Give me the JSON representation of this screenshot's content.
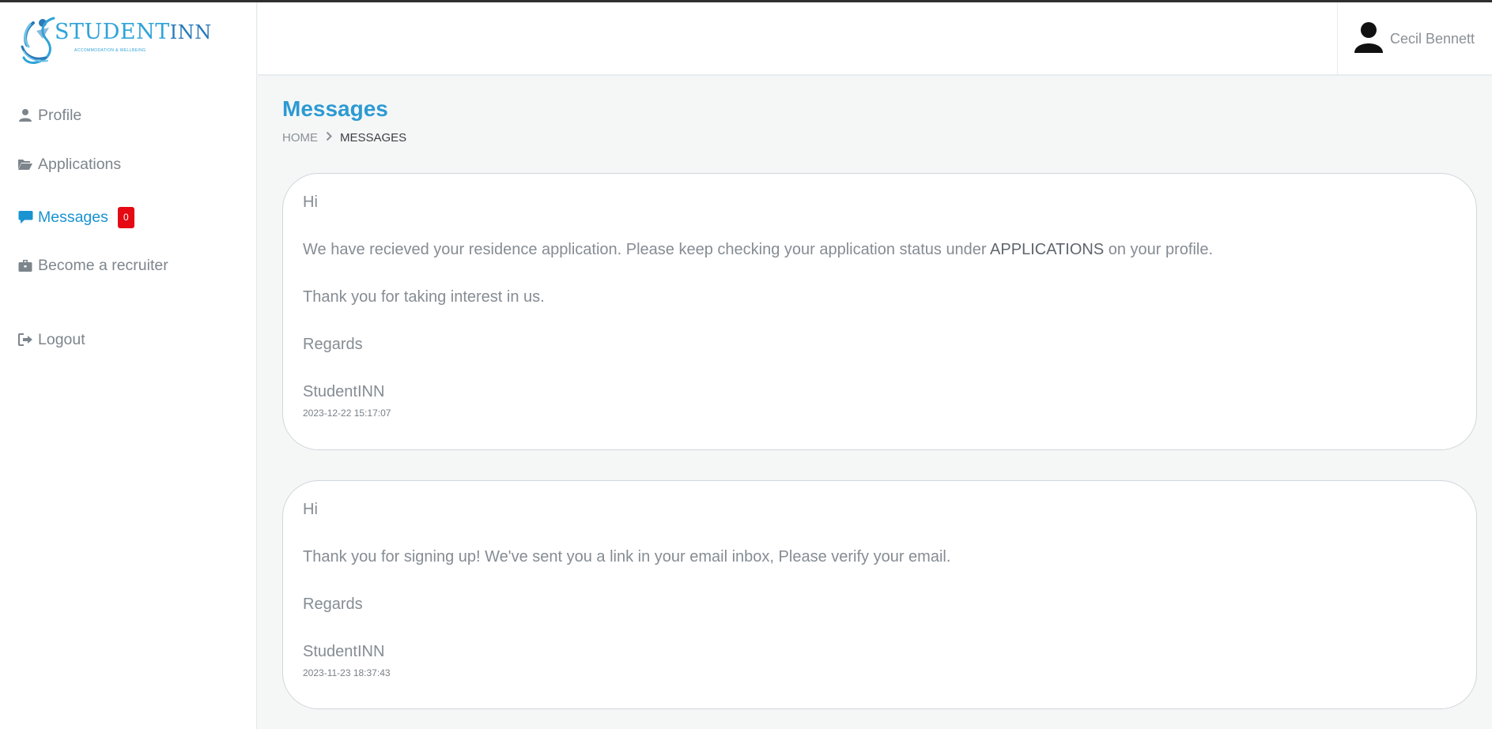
{
  "brand": {
    "name_prefix": "S",
    "name_main": "TUDENT",
    "name_suffix": "INN",
    "tagline": "ACCOMMODATION & WELLBEING"
  },
  "sidebar": {
    "items": [
      {
        "label": "Profile",
        "icon": "user-icon"
      },
      {
        "label": "Applications",
        "icon": "folder-open-icon"
      },
      {
        "label": "Messages",
        "icon": "comment-icon",
        "badge": "0",
        "active": true
      },
      {
        "label": "Become a recruiter",
        "icon": "briefcase-icon"
      },
      {
        "label": "Logout",
        "icon": "sign-out-icon"
      }
    ]
  },
  "header": {
    "user_name": "Cecil Bennett"
  },
  "main": {
    "title": "Messages",
    "breadcrumb": {
      "home": "HOME",
      "current": "MESSAGES"
    },
    "messages": [
      {
        "greeting": "Hi",
        "body_before": "We have recieved your residence application. Please keep checking your application status under ",
        "body_strong": "APPLICATIONS",
        "body_after": " on your profile.",
        "line2": "Thank you for taking interest in us.",
        "regards": "Regards",
        "signature": "StudentINN",
        "date": "2023-12-22 15:17:07"
      },
      {
        "greeting": "Hi",
        "body": "Thank you for signing up! We've sent you a link in your email inbox, Please verify your email.",
        "regards": "Regards",
        "signature": "StudentINN",
        "date": "2023-11-23 18:37:43"
      }
    ]
  },
  "colors": {
    "accent": "#2d9ad3",
    "active_nav": "#1a93d1",
    "badge": "#e50914",
    "background": "#f5f7f7"
  }
}
